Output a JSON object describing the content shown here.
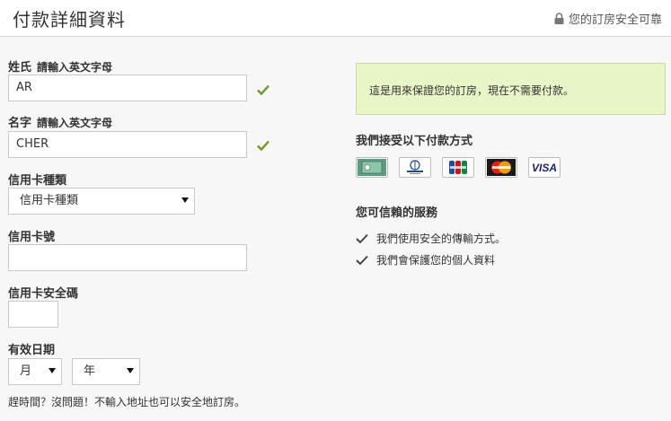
{
  "header": {
    "title": "付款詳細資料",
    "secure_text": "您的訂房安全可靠"
  },
  "form": {
    "last_name": {
      "label": "姓氏",
      "hint": "請輸入英文字母",
      "value": "AR"
    },
    "first_name": {
      "label": "名字",
      "hint": "請輸入英文字母",
      "value": "CHER"
    },
    "card_type": {
      "label": "信用卡種類",
      "selected": "信用卡種類"
    },
    "card_number": {
      "label": "信用卡號",
      "value": ""
    },
    "cvv": {
      "label": "信用卡安全碼",
      "value": ""
    },
    "expiry": {
      "label": "有效日期",
      "month": "月",
      "year": "年"
    },
    "note": "趕時間？沒問題！不輸入地址也可以安全地訂房。"
  },
  "right": {
    "info_box": "這是用來保證您的訂房，現在不需要付款。",
    "payment_heading": "我們接受以下付款方式",
    "cards": [
      "amex-icon",
      "diners-club-icon",
      "jcb-icon",
      "mastercard-icon",
      "visa-icon"
    ],
    "visa_text": "VISA",
    "trust_heading": "您可信賴的服務",
    "trust_items": [
      "我們使用安全的傳輸方式。",
      "我們會保護您的個人資料"
    ]
  },
  "colors": {
    "check_green": "#6a9a24",
    "info_bg": "#e8f5c6",
    "panel_bg": "#f7f7f7"
  }
}
